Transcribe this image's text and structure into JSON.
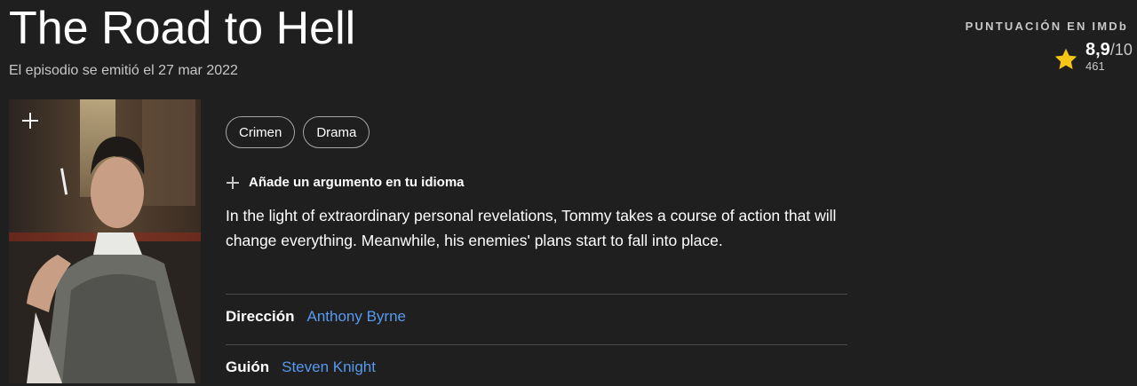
{
  "episode": {
    "title": "The Road to Hell",
    "airdate": "El episodio se emitió el 27 mar 2022"
  },
  "rating": {
    "label": "PUNTUACIÓN EN IMDb",
    "score": "8,9",
    "outof": "/10",
    "votes": "461"
  },
  "genres": [
    "Crimen",
    "Drama"
  ],
  "plot": {
    "add_label": "Añade un argumento en tu idioma",
    "text": "In the light of extraordinary personal revelations, Tommy takes a course of action that will change everything. Meanwhile, his enemies' plans start to fall into place."
  },
  "credits": {
    "director": {
      "label": "Dirección",
      "name": "Anthony Byrne"
    },
    "writer": {
      "label": "Guión",
      "name": "Steven Knight"
    }
  },
  "colors": {
    "background": "#1f1f1f",
    "link": "#5799ef",
    "star": "#f5c518"
  }
}
